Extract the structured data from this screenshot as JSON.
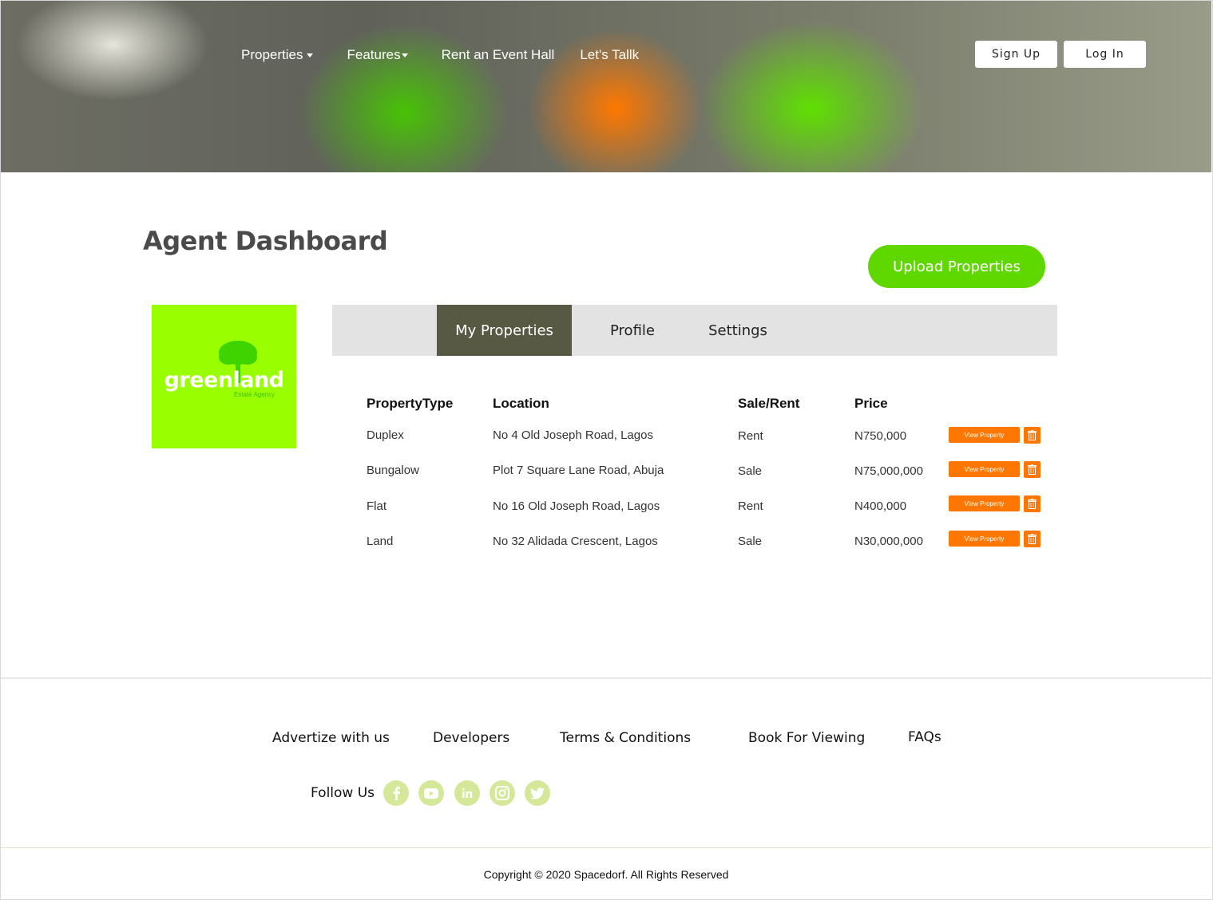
{
  "header": {
    "nav": {
      "properties": "Properties",
      "features": "Features",
      "rent_hall": "Rent an Event Hall",
      "lets_talk": "Let's Tallk"
    },
    "sign_up": "Sign Up",
    "log_in": "Log In"
  },
  "main": {
    "title": "Agent Dashboard",
    "upload_label": "Upload Properties",
    "logo": {
      "word": "greenland",
      "subtitle": "Estate Agency"
    },
    "tabs": [
      "My Properties",
      "Profile",
      "Settings"
    ],
    "active_tab": "My Properties",
    "table": {
      "headers": [
        "PropertyType",
        "Location",
        "Sale/Rent",
        "Price"
      ],
      "rows": [
        {
          "type": "Duplex",
          "location": "No 4 Old Joseph Road, Lagos",
          "mode": "Rent",
          "price": "N750,000"
        },
        {
          "type": "Bungalow",
          "location": "Plot 7 Square Lane Road, Abuja",
          "mode": "Sale",
          "price": "N75,000,000"
        },
        {
          "type": "Flat",
          "location": "No 16 Old Joseph Road, Lagos",
          "mode": "Rent",
          "price": "N400,000"
        },
        {
          "type": "Land",
          "location": "No 32 Alidada Crescent, Lagos",
          "mode": "Sale",
          "price": "N30,000,000"
        }
      ],
      "view_label": "View Property"
    }
  },
  "footer": {
    "links": [
      "Advertize with us",
      "Developers",
      "Terms & Conditions",
      "Book For Viewing",
      "FAQs"
    ],
    "follow_us": "Follow Us",
    "social_icons": [
      "facebook-icon",
      "youtube-icon",
      "linkedin-icon",
      "instagram-icon",
      "twitter-icon"
    ],
    "copyright": "Copyright © 2020 Spacedorf. All Rights Reserved"
  },
  "colors": {
    "brand_green": "#5fd800",
    "logo_bg": "#99ff00",
    "accent_orange": "#ff7700",
    "active_tab": "#585943",
    "social_bg": "#d5e89a"
  }
}
